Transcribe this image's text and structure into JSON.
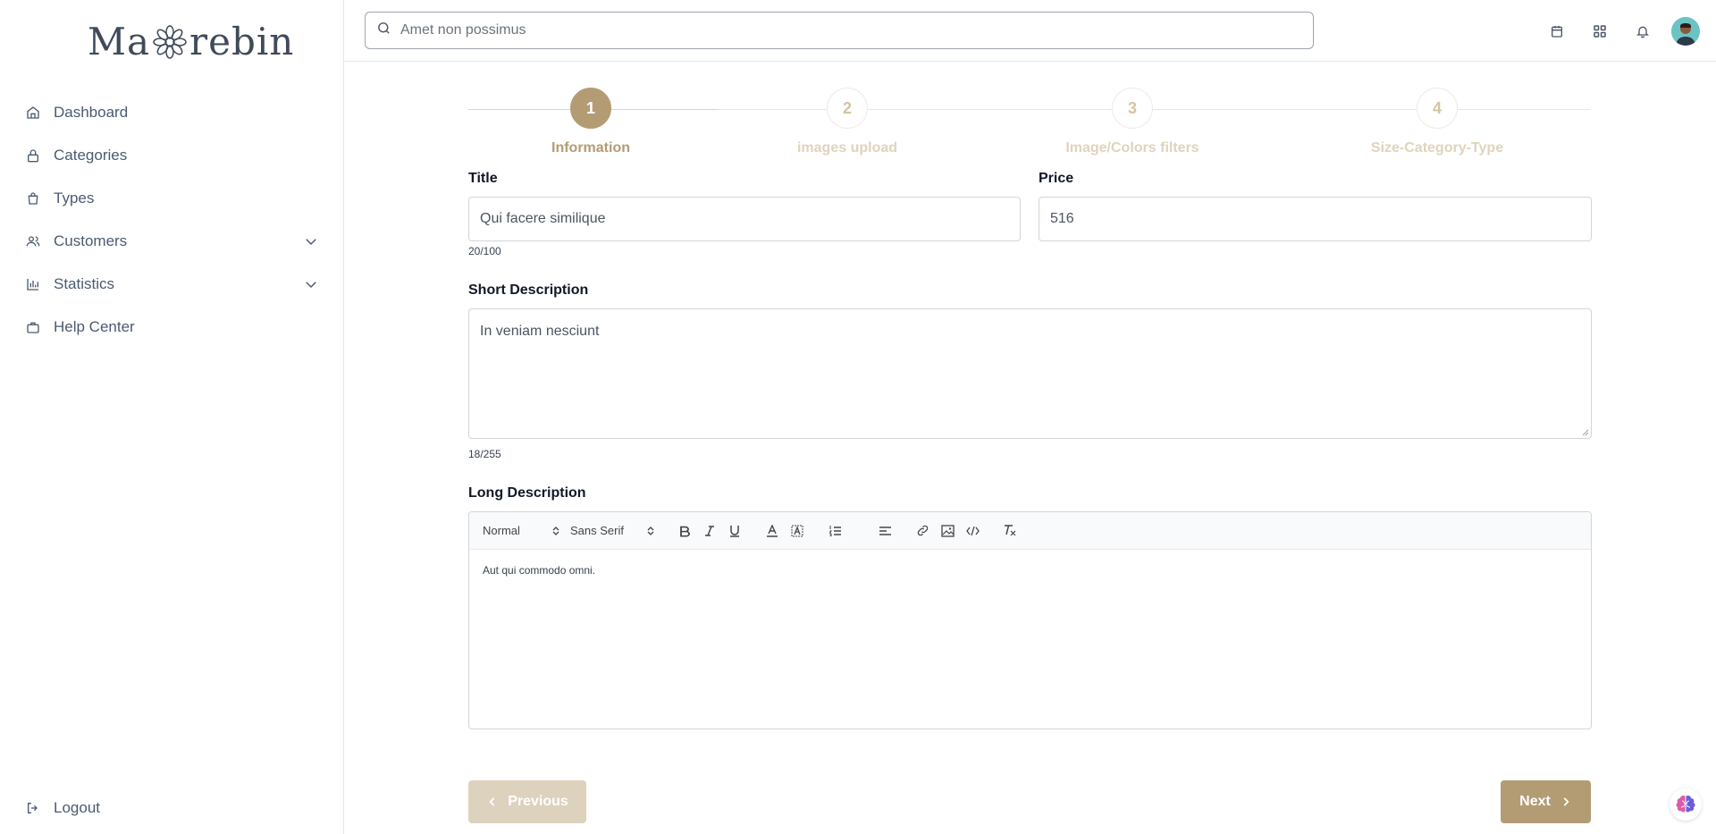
{
  "brand": {
    "logo_left": "Ma",
    "logo_right": "rebin"
  },
  "sidebar": {
    "items": [
      {
        "label": "Dashboard"
      },
      {
        "label": "Categories"
      },
      {
        "label": "Types"
      },
      {
        "label": "Customers"
      },
      {
        "label": "Statistics"
      },
      {
        "label": "Help Center"
      }
    ],
    "logout_label": "Logout"
  },
  "search": {
    "placeholder": "Amet non possimus"
  },
  "stepper": {
    "steps": [
      {
        "number": "1",
        "label": "Information"
      },
      {
        "number": "2",
        "label": "images upload"
      },
      {
        "number": "3",
        "label": "Image/Colors filters"
      },
      {
        "number": "4",
        "label": "Size-Category-Type"
      }
    ],
    "active_step": 1
  },
  "form": {
    "title": {
      "label": "Title",
      "value": "Qui facere similique",
      "counter": "20/100"
    },
    "price": {
      "label": "Price",
      "value": "516"
    },
    "short_description": {
      "label": "Short Description",
      "value": "In veniam nesciunt",
      "counter": "18/255"
    },
    "long_description": {
      "label": "Long Description",
      "toolbar": {
        "heading_select": "Normal",
        "font_select": "Sans Serif"
      },
      "content": "Aut qui commodo omni."
    }
  },
  "actions": {
    "previous_label": "Previous",
    "next_label": "Next"
  },
  "colors": {
    "accent": "#b39c74",
    "accent_light": "#ddd2bd",
    "nav_text": "#4b5a72"
  }
}
